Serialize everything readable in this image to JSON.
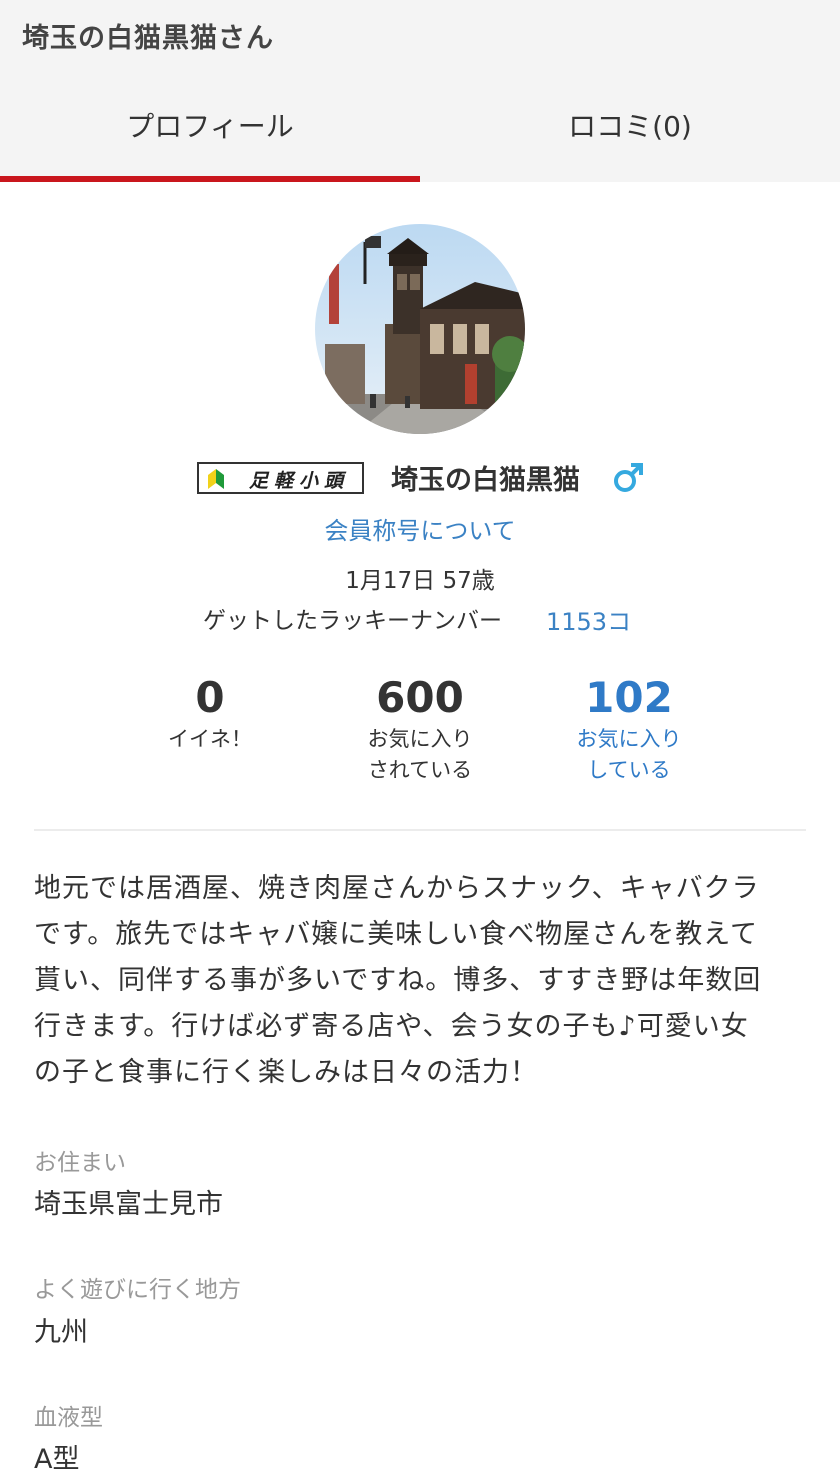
{
  "header": {
    "title": "埼玉の白猫黒猫さん"
  },
  "tabs": [
    {
      "label": "プロフィール",
      "active": true
    },
    {
      "label": "ロコミ(0)",
      "active": false
    }
  ],
  "colors": {
    "accent_red": "#c9161d",
    "link_blue": "#3b82c4",
    "male_icon": "#35a9df"
  },
  "profile": {
    "rank_text": "足軽小頭",
    "name": "埼玉の白猫黒猫",
    "gender_icon": "male-icon",
    "title_link": "会員称号について",
    "birthday_age": "1月17日 57歳",
    "lucky_label": "ゲットしたラッキーナンバー",
    "lucky_count": "1153コ"
  },
  "stats": [
    {
      "value": "0",
      "label_line1": "イイネ！",
      "label_line2": ""
    },
    {
      "value": "600",
      "label_line1": "お気に入り",
      "label_line2": "されている"
    },
    {
      "value": "102",
      "label_line1": "お気に入り",
      "label_line2": "している"
    }
  ],
  "bio": {
    "line1": "地元では居酒屋、焼き肉屋さんからスナック、キャバクラ",
    "line2": "です。旅先ではキャバ嬢に美味しい食べ物屋さんを教えて",
    "line3": "貰い、同伴する事が多いですね。博多、すすき野は年数回",
    "line4": "行きます。行けば必ず寄る店や、会う女の子も♪可愛い女",
    "line5": "の子と食事に行く楽しみは日々の活力！"
  },
  "fields": [
    {
      "label": "お住まい",
      "value": "埼玉県富士見市"
    },
    {
      "label": "よく遊びに行く地方",
      "value": "九州"
    },
    {
      "label": "血液型",
      "value": "A型"
    }
  ]
}
